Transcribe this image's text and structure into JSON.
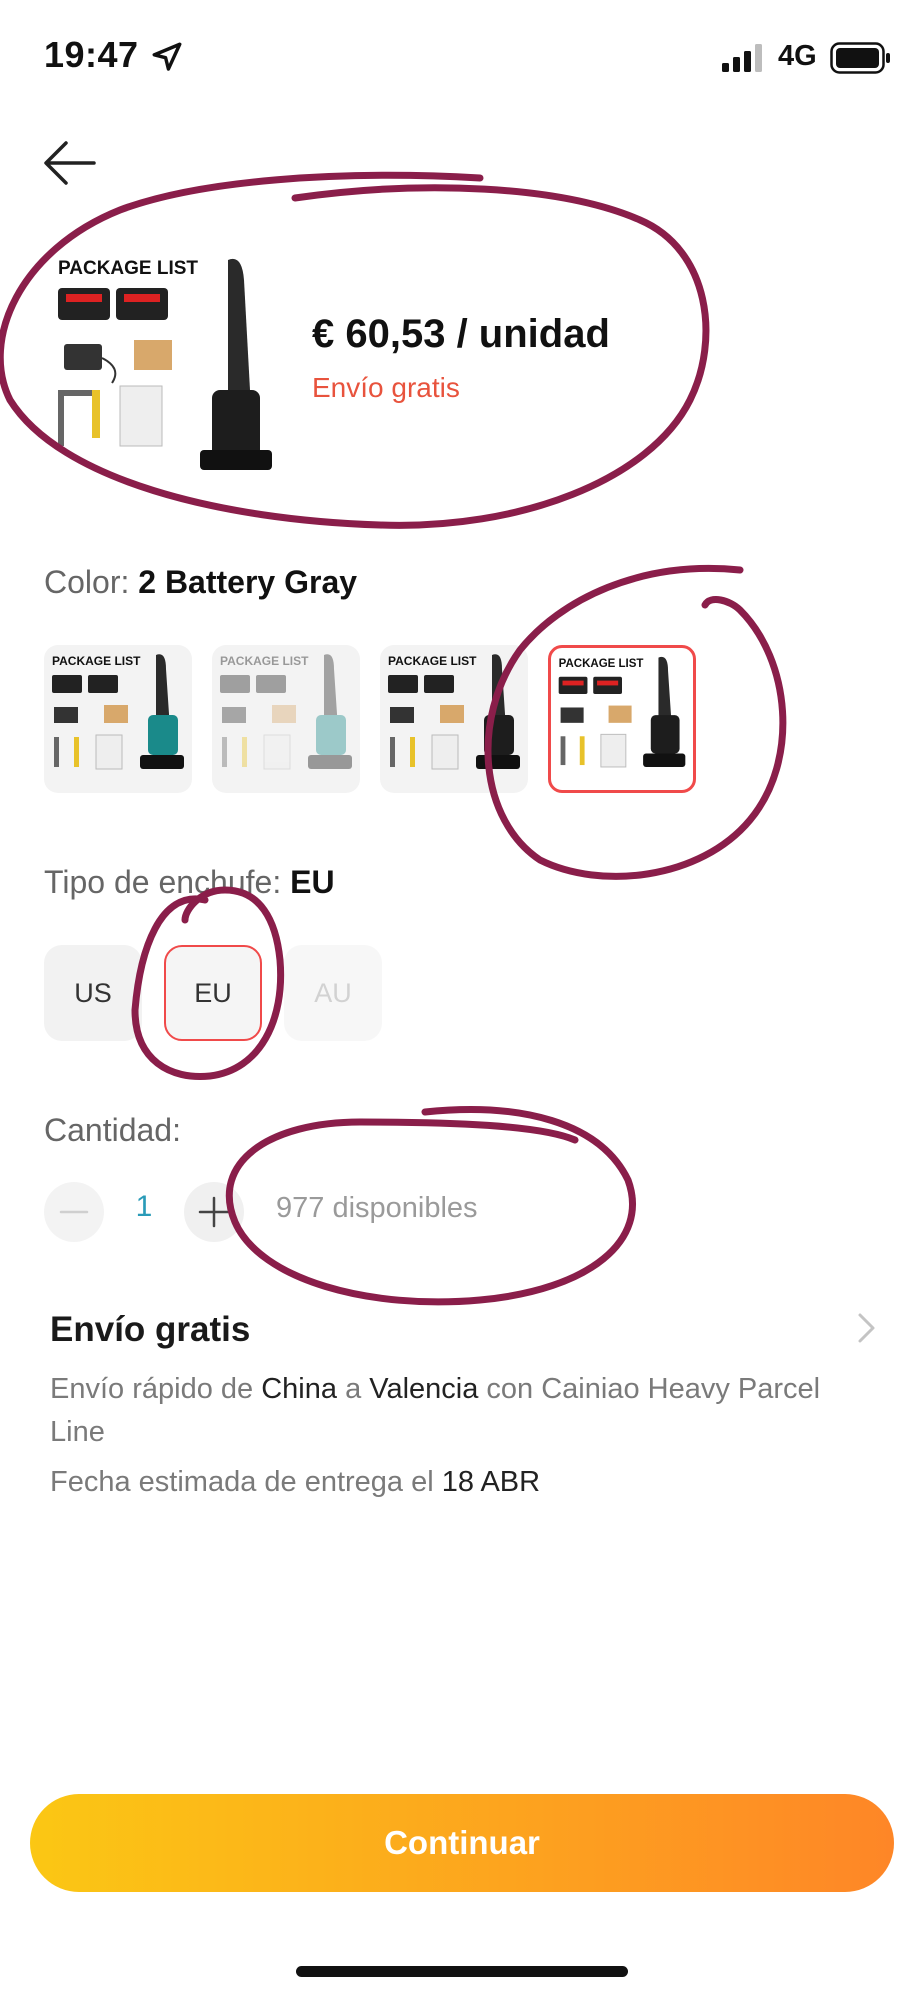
{
  "status_bar": {
    "time": "19:47",
    "network": "4G"
  },
  "product": {
    "price": "€ 60,53 / unidad",
    "shipping_label": "Envío gratis",
    "thumb_title": "PACKAGE LIST"
  },
  "color": {
    "label": "Color:",
    "selected": "2 Battery Gray",
    "options": [
      {
        "title": "PACKAGE LIST",
        "state": "normal"
      },
      {
        "title": "PACKAGE LIST",
        "state": "faded"
      },
      {
        "title": "PACKAGE LIST",
        "state": "normal"
      },
      {
        "title": "PACKAGE LIST",
        "state": "selected"
      }
    ]
  },
  "plug": {
    "label": "Tipo de enchufe:",
    "selected": "EU",
    "options": [
      {
        "label": "US",
        "state": "normal"
      },
      {
        "label": "EU",
        "state": "selected"
      },
      {
        "label": "AU",
        "state": "disabled"
      }
    ]
  },
  "quantity": {
    "label": "Cantidad:",
    "value": "1",
    "available": "977 disponibles"
  },
  "shipping": {
    "title": "Envío gratis",
    "line_prefix": "Envío rápido de",
    "origin": "China",
    "connector": "a",
    "destination": "Valencia",
    "line_suffix": "con Cainiao Heavy Parcel Line",
    "date_prefix": "Fecha estimada de entrega el",
    "date": "18 ABR"
  },
  "actions": {
    "continue": "Continuar"
  },
  "colors": {
    "accent_red": "#e8533d",
    "selection_border": "#f04a4a",
    "button_gradient_start": "#fbc714",
    "button_gradient_end": "#fe8627",
    "annotation_ink": "#8a1e4a",
    "qty_blue": "#2a9bb8"
  },
  "icons": [
    "location-arrow-icon",
    "signal-icon",
    "battery-icon",
    "back-arrow-icon",
    "minus-icon",
    "plus-icon",
    "chevron-right-icon"
  ]
}
